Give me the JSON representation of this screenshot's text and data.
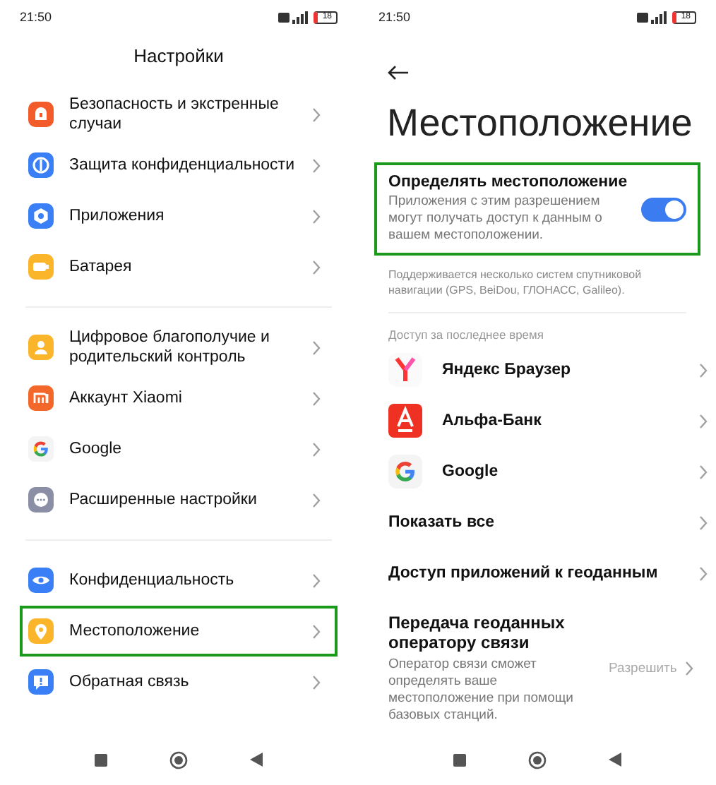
{
  "left_screen": {
    "status_bar": {
      "time": "21:50",
      "battery": "18"
    },
    "title": "Настройки",
    "groups": [
      [
        {
          "label": "Безопасность и экстренные случаи",
          "kind": "security",
          "highlighted": false
        },
        {
          "label": "Защита конфиденциальности",
          "kind": "privacy",
          "highlighted": false
        },
        {
          "label": "Приложения",
          "kind": "apps",
          "highlighted": false
        },
        {
          "label": "Батарея",
          "kind": "battery",
          "highlighted": false
        }
      ],
      [
        {
          "label": "Цифровое благополучие и родительский контроль",
          "kind": "wellbeing",
          "highlighted": false
        },
        {
          "label": "Аккаунт Xiaomi",
          "kind": "mi",
          "highlighted": false
        },
        {
          "label": "Google",
          "kind": "google",
          "highlighted": false
        },
        {
          "label": "Расширенные настройки",
          "kind": "more",
          "highlighted": false
        }
      ],
      [
        {
          "label": "Конфиденциальность",
          "kind": "eye",
          "highlighted": false
        },
        {
          "label": "Местоположение",
          "kind": "location",
          "highlighted": true
        },
        {
          "label": "Обратная связь",
          "kind": "feedback",
          "highlighted": false
        }
      ]
    ]
  },
  "right_screen": {
    "status_bar": {
      "time": "21:50",
      "battery": "18"
    },
    "title": "Местоположение",
    "location_toggle": {
      "title": "Определять местоположение",
      "description": "Приложения с этим разрешением могут получать доступ к данным о вашем местоположении.",
      "on": true,
      "highlighted": true
    },
    "note": "Поддерживается несколько систем спутниковой навигации (GPS, BeiDou, ГЛОНАСС, Galileo).",
    "recent_header": "Доступ за последнее время",
    "recent_apps": [
      {
        "name": "Яндекс Браузер",
        "kind": "yandex"
      },
      {
        "name": "Альфа-Банк",
        "kind": "alfa"
      },
      {
        "name": "Google",
        "kind": "google"
      }
    ],
    "links": [
      "Показать все",
      "Доступ приложений к геоданным"
    ],
    "carrier": {
      "title": "Передача геоданных оператору связи",
      "description": "Оператор связи сможет определять ваше местоположение при помощи базовых станций.",
      "value": "Разрешить"
    }
  }
}
